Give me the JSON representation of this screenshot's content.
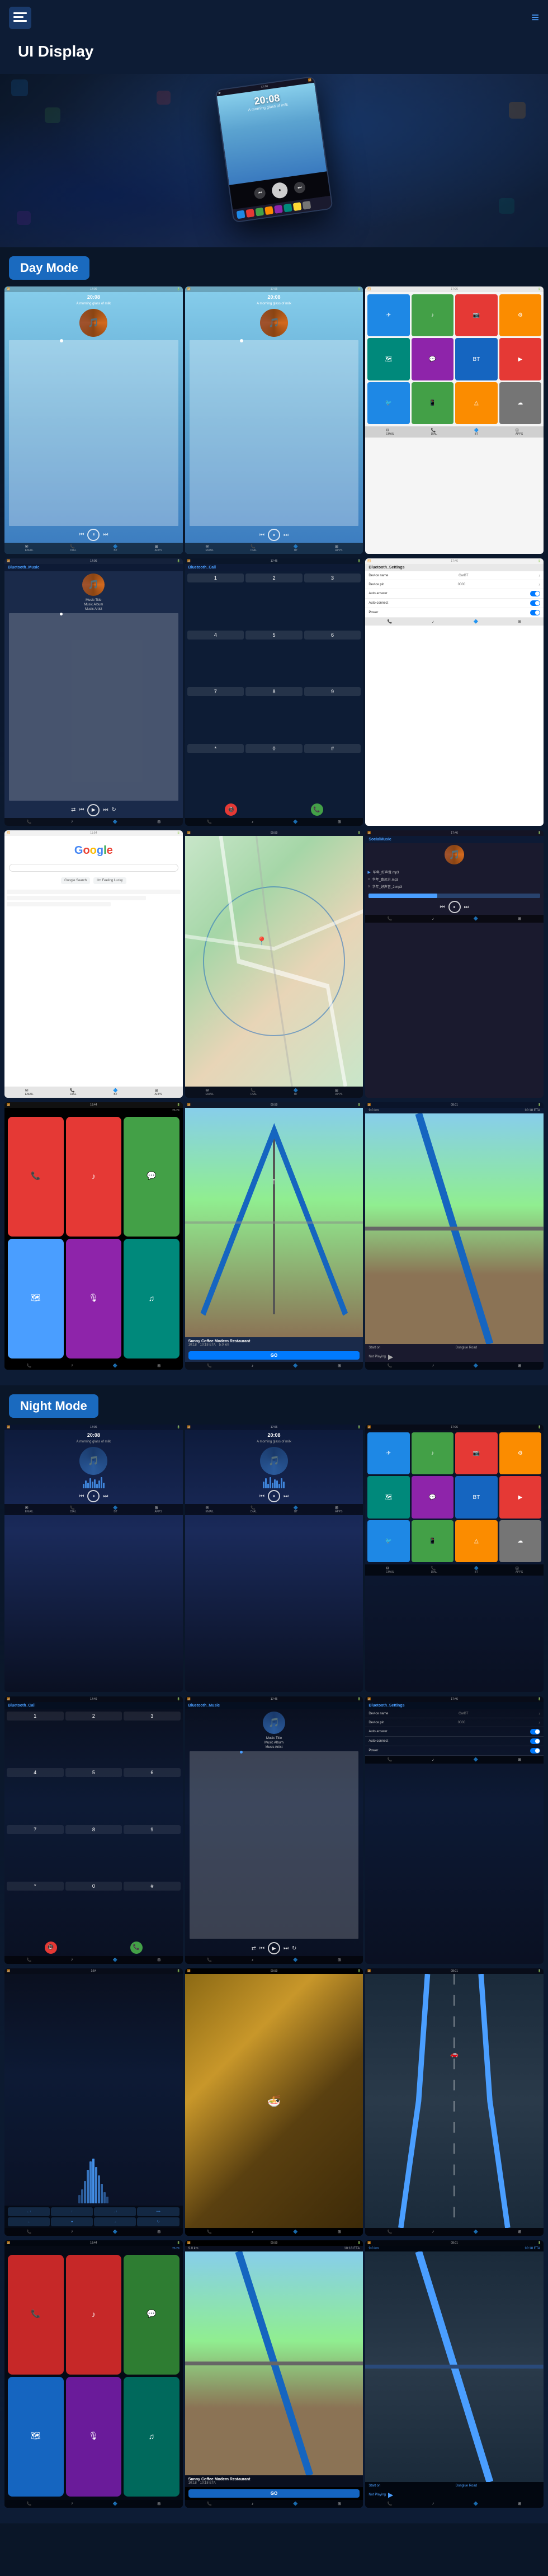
{
  "header": {
    "title": "UI Display",
    "menu_icon": "☰",
    "nav_icon": "≡"
  },
  "hero": {
    "device_time": "20:08",
    "subtitle": "A morning glass of milk"
  },
  "modes": {
    "day": {
      "label": "Day Mode",
      "screens": [
        {
          "id": "day-music-1",
          "type": "music",
          "time": "20:08",
          "subtitle": "A morning glass of milk"
        },
        {
          "id": "day-music-2",
          "type": "music",
          "time": "20:08",
          "subtitle": "A morning glass of milk"
        },
        {
          "id": "day-apps",
          "type": "apps"
        },
        {
          "id": "day-bt-music",
          "type": "bluetooth-music",
          "title": "Bluetooth_Music"
        },
        {
          "id": "day-bt-call",
          "type": "bluetooth-call",
          "title": "Bluetooth_Call"
        },
        {
          "id": "day-bt-settings",
          "type": "bluetooth-settings",
          "title": "Bluetooth_Settings"
        },
        {
          "id": "day-google",
          "type": "google"
        },
        {
          "id": "day-map",
          "type": "map"
        },
        {
          "id": "day-social",
          "type": "social",
          "title": "SocialMusic"
        },
        {
          "id": "day-carplay",
          "type": "carplay"
        },
        {
          "id": "day-nav",
          "type": "navigation",
          "address": "Sunny Coffee Modern Restaurant",
          "distance": "5.0 km",
          "eta": "10:18 ETA",
          "go": "GO"
        },
        {
          "id": "day-not-playing",
          "type": "not-playing"
        }
      ]
    },
    "night": {
      "label": "Night Mode",
      "screens": [
        {
          "id": "night-music-1",
          "type": "music-night",
          "time": "20:08",
          "subtitle": "A morning glass of milk"
        },
        {
          "id": "night-music-2",
          "type": "music-night",
          "time": "20:08",
          "subtitle": "A morning glass of milk"
        },
        {
          "id": "night-apps",
          "type": "apps-night"
        },
        {
          "id": "night-bt-call",
          "type": "bluetooth-call-night",
          "title": "Bluetooth_Call"
        },
        {
          "id": "night-bt-music",
          "type": "bluetooth-music-night",
          "title": "Bluetooth_Music"
        },
        {
          "id": "night-bt-settings",
          "type": "bluetooth-settings-night",
          "title": "Bluetooth_Settings"
        },
        {
          "id": "night-waveform",
          "type": "waveform-screen"
        },
        {
          "id": "night-food",
          "type": "food-photo"
        },
        {
          "id": "night-road-nav",
          "type": "road-nav-night"
        },
        {
          "id": "night-carplay",
          "type": "carplay-night"
        },
        {
          "id": "night-nav",
          "type": "navigation-night",
          "address": "Sunny Coffee Modern Restaurant",
          "distance": "5.0 km",
          "eta": "10:18 ETA",
          "go": "GO"
        },
        {
          "id": "night-not-playing",
          "type": "not-playing-night"
        }
      ]
    }
  },
  "music": {
    "title": "Music Title",
    "album": "Music Album",
    "artist": "Music Artist"
  },
  "bluetooth_settings": {
    "device_name_label": "Device name",
    "device_name_value": "CarBT",
    "device_pin_label": "Device pin",
    "device_pin_value": "0000",
    "auto_answer_label": "Auto answer",
    "auto_connect_label": "Auto connect",
    "power_label": "Power"
  },
  "navigation": {
    "address": "Sunny Coffee Modern Restaurant",
    "distance": "5.0 km",
    "eta": "10:18 ETA",
    "time": "10:18",
    "go_label": "GO",
    "start_on": "Start on",
    "street": "Donglue Road",
    "distance2": "9.0 km"
  },
  "social_music": {
    "items": [
      "华年_好声音.mp3",
      "华年_致远方.mp3",
      "华年_好声音_2.mp3"
    ]
  },
  "app_colors": {
    "blue": "#1e88e5",
    "red": "#e53935",
    "green": "#43a047",
    "orange": "#fb8c00",
    "purple": "#8e24aa",
    "teal": "#00897b"
  }
}
